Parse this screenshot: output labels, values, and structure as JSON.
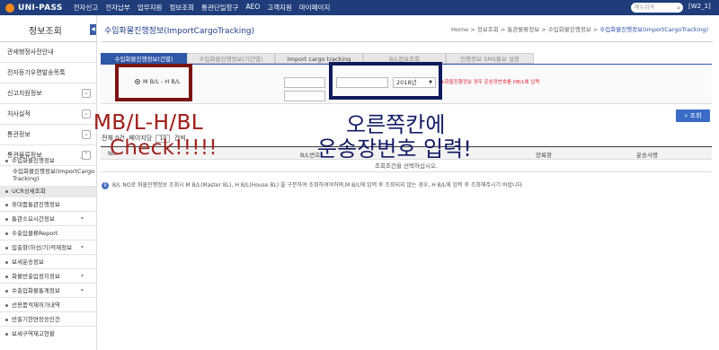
{
  "header": {
    "logo": "UNI-PASS",
    "menu": [
      "전자신고",
      "전자납부",
      "업무지원",
      "정보조회",
      "통관단일창구",
      "AEO",
      "고객지원",
      "마이페이지"
    ],
    "search_placeholder": "메뉴검색",
    "user": "[W2_1]"
  },
  "sidebar": {
    "title": "정보조회",
    "collapse_icon": "◀",
    "items": [
      {
        "label": "관세행정사전안내"
      },
      {
        "label": "전자등기우편발송목록"
      },
      {
        "label": "신고지원정보"
      },
      {
        "label": "처사실적"
      },
      {
        "label": "통관정보"
      },
      {
        "label": "통관물류정보"
      }
    ],
    "sub_items": [
      {
        "label": "수입화물진행정보"
      },
      {
        "label": "수입화물진행정보(ImportCargo Tracking)"
      },
      {
        "label": "UCR상세조회"
      },
      {
        "label": "휴대품통관진행정보"
      },
      {
        "label": "통관소요시간정보"
      },
      {
        "label": "수출입물류Report"
      },
      {
        "label": "입출항(하선/기)적재정보"
      },
      {
        "label": "보세운송정보"
      },
      {
        "label": "화물반출입정지정보"
      },
      {
        "label": "수출입화물통계정보"
      },
      {
        "label": "선용품적재허가내역"
      },
      {
        "label": "반출기한연장승인건"
      },
      {
        "label": "보세구역재고현황"
      }
    ]
  },
  "page": {
    "title": "수입화물진행정보(ImportCargoTracking)",
    "breadcrumb": [
      "Home",
      "정보조회",
      "통관물류정보",
      "수입화물진행정보",
      "수입화물진행정보(ImportCargoTracking)"
    ]
  },
  "tabs": [
    "수입화물진행정보(건별)",
    "수입화물진행정보(기간별)",
    "Import cargo tracking",
    "B/L정보조회",
    "진행정보 SMS통보 설정"
  ],
  "form": {
    "radio_label": "M B/L - H B/L",
    "year": "2018년",
    "note": "※화물진행정보 경우 운송장번호를 HB/L에 입력"
  },
  "search_button": "조회",
  "list": {
    "total_label": "전체 0건",
    "page_label": "페이지당",
    "page_size": "10",
    "unit_label": "건씩"
  },
  "table": {
    "columns": [
      "No.",
      "B/L번호",
      "양륙항",
      "운송사명"
    ],
    "empty_message": "조회조건을 선택하십시오."
  },
  "info_note": "B/L NO로 화물진행정보 조회시 M B/L(Master BL), H B/L(House BL) 을 구분하여 조회하여야하며,M B/L에 입력 후 조회되지 않는 경우, H B/L에 입력 후 조회해주시기 바랍니다.",
  "annotations": {
    "red_line1": "MB/L-H/BL",
    "red_line2": "Check!!!!!",
    "navy_line1": "오른쪽칸에",
    "navy_line2": "운송장번호 입력!",
    "red_color": "#a1241f",
    "navy_color": "#131c66"
  }
}
